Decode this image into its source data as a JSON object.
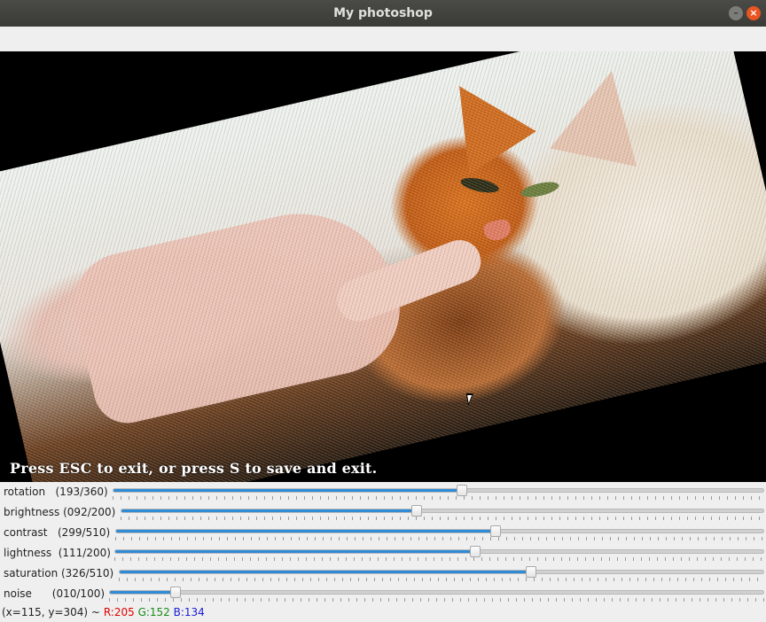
{
  "window": {
    "title": "My photoshop",
    "minimize_icon": "minimize-icon",
    "close_icon": "close-icon"
  },
  "canvas": {
    "overlay_text": "Press ESC to exit, or press S to save and exit.",
    "image_subject": "cat-photo"
  },
  "sliders": [
    {
      "label": "rotation   (193/360)",
      "value": 193,
      "max": 360
    },
    {
      "label": "brightness (092/200)",
      "value": 92,
      "max": 200
    },
    {
      "label": "contrast   (299/510)",
      "value": 299,
      "max": 510
    },
    {
      "label": "lightness  (111/200)",
      "value": 111,
      "max": 200
    },
    {
      "label": "saturation (326/510)",
      "value": 326,
      "max": 510
    },
    {
      "label": "noise      (010/100)",
      "value": 10,
      "max": 100
    }
  ],
  "status": {
    "coords": "(x=115, y=304) ~",
    "r": "R:205",
    "g": "G:152",
    "b": "B:134"
  },
  "colors": {
    "accent": "#2f8bd6",
    "close": "#e95420",
    "r": "#e00000",
    "g": "#1a8a1a",
    "b": "#1a1ad8"
  }
}
